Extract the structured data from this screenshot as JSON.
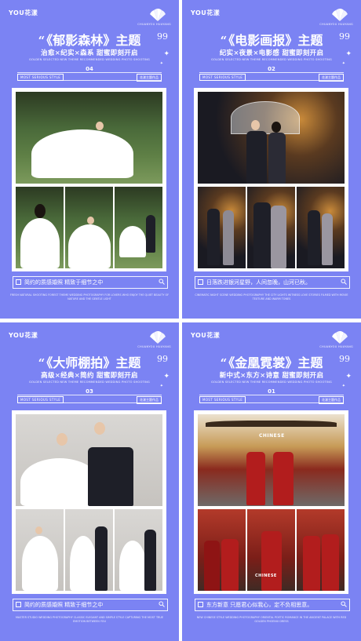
{
  "posters": [
    {
      "logo": "YOU花漾",
      "brand_small": "CHUANYOU HUAYANG",
      "title": "郁影森林",
      "title_suffix": "主题",
      "subtitle": "治愈×纪实×森系  甜蜜即刻开启",
      "english": "GOLDEN SELECTED NEW THEME  RECOMMENDED WEDDING PHOTO SHOOTING",
      "number": "04",
      "style_left": "MOST SERIOUS STYLE",
      "style_right": "花漾主题作品",
      "caption": "简约的质感婚照  精致于细节之中",
      "footer": "FRESH NATURAL SHOOTING FOREST THEME WEDDING PHOTOGRAPHY FOR LOVERS WHO ENJOY THE QUIET BEAUTY OF NATURE AND THE GENTLE LIGHT"
    },
    {
      "logo": "YOU花漾",
      "brand_small": "CHUANYOU HUAYANG",
      "title": "电影画报",
      "title_suffix": "主题",
      "subtitle": "纪实×夜景×电影感  甜蜜即刻开启",
      "english": "GOLDEN SELECTED NEW THEME  RECOMMENDED WEDDING PHOTO SHOOTING",
      "number": "02",
      "style_left": "MOST SERIOUS STYLE",
      "style_right": "花漾主题作品",
      "caption": "日落跌进银河星野，人间忽晚，山河已秋。",
      "footer": "CINEMATIC NIGHT SCENE WEDDING PHOTOGRAPHY THE CITY LIGHTS WITNESS LOVE STORIES FILMED WITH MOVIE TEXTURE AND WARM TONES"
    },
    {
      "logo": "YOU花漾",
      "brand_small": "CHUANYOU HUAYANG",
      "title": "大师棚拍",
      "title_suffix": "主题",
      "subtitle": "高级×经典×简约  甜蜜即刻开启",
      "english": "GOLDEN SELECTED NEW THEME  RECOMMENDED WEDDING PHOTO SHOOTING",
      "number": "03",
      "style_left": "MOST SERIOUS STYLE",
      "style_right": "花漾主题作品",
      "caption": "简约的质感婚照  精致于细节之中",
      "footer": "MASTER STUDIO WEDDING PHOTOGRAPHY CLASSIC ELEGANT AND SIMPLE STYLE CAPTURING THE MOST TRUE EMOTION BETWEEN YOU"
    },
    {
      "logo": "YOU花漾",
      "brand_small": "CHUANYOU HUAYANG",
      "title": "金凰霓裳",
      "title_suffix": "主题",
      "subtitle": "新中式×东方×诗意  甜蜜即刻开启",
      "english": "GOLDEN SELECTED NEW THEME  RECOMMENDED WEDDING PHOTO SHOOTING",
      "number": "01",
      "style_left": "MOST SERIOUS STYLE",
      "style_right": "花漾主题作品",
      "caption": "东方新意  只愿君心似我心，定不负相思意。",
      "footer": "NEW CHINESE STYLE WEDDING PHOTOGRAPHY ORIENTAL POETIC ROMANCE IN THE ANCIENT PALACE WITH RED GOLDEN PHOENIX DRESS"
    }
  ],
  "photo_labels": {
    "chinese_a": "CHINESE",
    "chinese_b": "CHINESE"
  },
  "colors": {
    "background": "#7b83f3",
    "frame": "#ffffff",
    "text": "#ffffff"
  }
}
